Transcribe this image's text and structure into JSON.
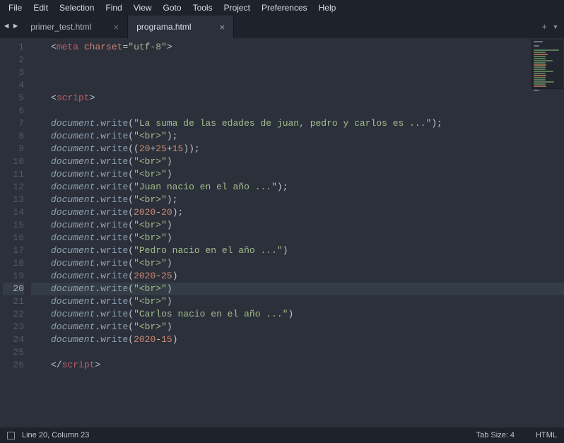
{
  "menu": {
    "items": [
      "File",
      "Edit",
      "Selection",
      "Find",
      "View",
      "Goto",
      "Tools",
      "Project",
      "Preferences",
      "Help"
    ]
  },
  "tabs": {
    "nav_back": "◄",
    "nav_fwd": "►",
    "items": [
      {
        "label": "primer_test.html",
        "active": false
      },
      {
        "label": "programa.html",
        "active": true
      }
    ],
    "add": "+",
    "more": "▾"
  },
  "status": {
    "position": "Line 20, Column 23",
    "tabsize": "Tab Size: 4",
    "lang": "HTML"
  },
  "editor": {
    "current_line": 20,
    "lines": [
      {
        "n": 1,
        "tokens": [
          [
            "ab",
            "<"
          ],
          [
            "tg",
            "meta"
          ],
          [
            "p",
            " "
          ],
          [
            "at",
            "charset"
          ],
          [
            "eq",
            "="
          ],
          [
            "st",
            "\"utf-8\""
          ],
          [
            "ab",
            ">"
          ]
        ]
      },
      {
        "n": 2,
        "tokens": []
      },
      {
        "n": 3,
        "tokens": []
      },
      {
        "n": 4,
        "tokens": []
      },
      {
        "n": 5,
        "tokens": [
          [
            "ab",
            "<"
          ],
          [
            "tg",
            "script"
          ],
          [
            "ab",
            ">"
          ]
        ]
      },
      {
        "n": 6,
        "tokens": []
      },
      {
        "n": 7,
        "tokens": [
          [
            "ob",
            "document"
          ],
          [
            "p",
            "."
          ],
          [
            "fn",
            "write"
          ],
          [
            "p",
            "("
          ],
          [
            "st",
            "\"La suma de las edades de juan, pedro y carlos es ...\""
          ],
          [
            "p",
            ");"
          ]
        ]
      },
      {
        "n": 8,
        "tokens": [
          [
            "ob",
            "document"
          ],
          [
            "p",
            "."
          ],
          [
            "fn",
            "write"
          ],
          [
            "p",
            "("
          ],
          [
            "st",
            "\"<br>\""
          ],
          [
            "p",
            ");"
          ]
        ]
      },
      {
        "n": 9,
        "tokens": [
          [
            "ob",
            "document"
          ],
          [
            "p",
            "."
          ],
          [
            "fn",
            "write"
          ],
          [
            "p",
            "(("
          ],
          [
            "nu",
            "20"
          ],
          [
            "op",
            "+"
          ],
          [
            "nu",
            "25"
          ],
          [
            "op",
            "+"
          ],
          [
            "nu",
            "15"
          ],
          [
            "p",
            "));"
          ]
        ]
      },
      {
        "n": 10,
        "tokens": [
          [
            "ob",
            "document"
          ],
          [
            "p",
            "."
          ],
          [
            "fn",
            "write"
          ],
          [
            "p",
            "("
          ],
          [
            "st",
            "\"<br>\""
          ],
          [
            "p",
            ")"
          ]
        ]
      },
      {
        "n": 11,
        "tokens": [
          [
            "ob",
            "document"
          ],
          [
            "p",
            "."
          ],
          [
            "fn",
            "write"
          ],
          [
            "p",
            "("
          ],
          [
            "st",
            "\"<br>\""
          ],
          [
            "p",
            ")"
          ]
        ]
      },
      {
        "n": 12,
        "tokens": [
          [
            "ob",
            "document"
          ],
          [
            "p",
            "."
          ],
          [
            "fn",
            "write"
          ],
          [
            "p",
            "("
          ],
          [
            "st",
            "\"Juan nacio en el año ...\""
          ],
          [
            "p",
            ");"
          ]
        ]
      },
      {
        "n": 13,
        "tokens": [
          [
            "ob",
            "document"
          ],
          [
            "p",
            "."
          ],
          [
            "fn",
            "write"
          ],
          [
            "p",
            "("
          ],
          [
            "st",
            "\"<br>\""
          ],
          [
            "p",
            ");"
          ]
        ]
      },
      {
        "n": 14,
        "tokens": [
          [
            "ob",
            "document"
          ],
          [
            "p",
            "."
          ],
          [
            "fn",
            "write"
          ],
          [
            "p",
            "("
          ],
          [
            "nu",
            "2020"
          ],
          [
            "op",
            "-"
          ],
          [
            "nu",
            "20"
          ],
          [
            "p",
            ");"
          ]
        ]
      },
      {
        "n": 15,
        "tokens": [
          [
            "ob",
            "document"
          ],
          [
            "p",
            "."
          ],
          [
            "fn",
            "write"
          ],
          [
            "p",
            "("
          ],
          [
            "st",
            "\"<br>\""
          ],
          [
            "p",
            ")"
          ]
        ]
      },
      {
        "n": 16,
        "tokens": [
          [
            "ob",
            "document"
          ],
          [
            "p",
            "."
          ],
          [
            "fn",
            "write"
          ],
          [
            "p",
            "("
          ],
          [
            "st",
            "\"<br>\""
          ],
          [
            "p",
            ")"
          ]
        ]
      },
      {
        "n": 17,
        "tokens": [
          [
            "ob",
            "document"
          ],
          [
            "p",
            "."
          ],
          [
            "fn",
            "write"
          ],
          [
            "p",
            "("
          ],
          [
            "st",
            "\"Pedro nacio en el año ...\""
          ],
          [
            "p",
            ")"
          ]
        ]
      },
      {
        "n": 18,
        "tokens": [
          [
            "ob",
            "document"
          ],
          [
            "p",
            "."
          ],
          [
            "fn",
            "write"
          ],
          [
            "p",
            "("
          ],
          [
            "st",
            "\"<br>\""
          ],
          [
            "p",
            ")"
          ]
        ]
      },
      {
        "n": 19,
        "tokens": [
          [
            "ob",
            "document"
          ],
          [
            "p",
            "."
          ],
          [
            "fn",
            "write"
          ],
          [
            "p",
            "("
          ],
          [
            "nu",
            "2020"
          ],
          [
            "op",
            "-"
          ],
          [
            "nu",
            "25"
          ],
          [
            "p",
            ")"
          ]
        ]
      },
      {
        "n": 20,
        "tokens": [
          [
            "ob",
            "document"
          ],
          [
            "p",
            "."
          ],
          [
            "fn",
            "write"
          ],
          [
            "p",
            "("
          ],
          [
            "st",
            "\"<br>\""
          ],
          [
            "p",
            ")"
          ]
        ]
      },
      {
        "n": 21,
        "tokens": [
          [
            "ob",
            "document"
          ],
          [
            "p",
            "."
          ],
          [
            "fn",
            "write"
          ],
          [
            "p",
            "("
          ],
          [
            "st",
            "\"<br>\""
          ],
          [
            "p",
            ")"
          ]
        ]
      },
      {
        "n": 22,
        "tokens": [
          [
            "ob",
            "document"
          ],
          [
            "p",
            "."
          ],
          [
            "fn",
            "write"
          ],
          [
            "p",
            "("
          ],
          [
            "st",
            "\"Carlos nacio en el año ...\""
          ],
          [
            "p",
            ")"
          ]
        ]
      },
      {
        "n": 23,
        "tokens": [
          [
            "ob",
            "document"
          ],
          [
            "p",
            "."
          ],
          [
            "fn",
            "write"
          ],
          [
            "p",
            "("
          ],
          [
            "st",
            "\"<br>\""
          ],
          [
            "p",
            ")"
          ]
        ]
      },
      {
        "n": 24,
        "tokens": [
          [
            "ob",
            "document"
          ],
          [
            "p",
            "."
          ],
          [
            "fn",
            "write"
          ],
          [
            "p",
            "("
          ],
          [
            "nu",
            "2020"
          ],
          [
            "op",
            "-"
          ],
          [
            "nu",
            "15"
          ],
          [
            "p",
            ")"
          ]
        ]
      },
      {
        "n": 25,
        "tokens": []
      },
      {
        "n": 26,
        "tokens": [
          [
            "ab",
            "</"
          ],
          [
            "tg",
            "script"
          ],
          [
            "ab",
            ">"
          ]
        ]
      }
    ]
  }
}
